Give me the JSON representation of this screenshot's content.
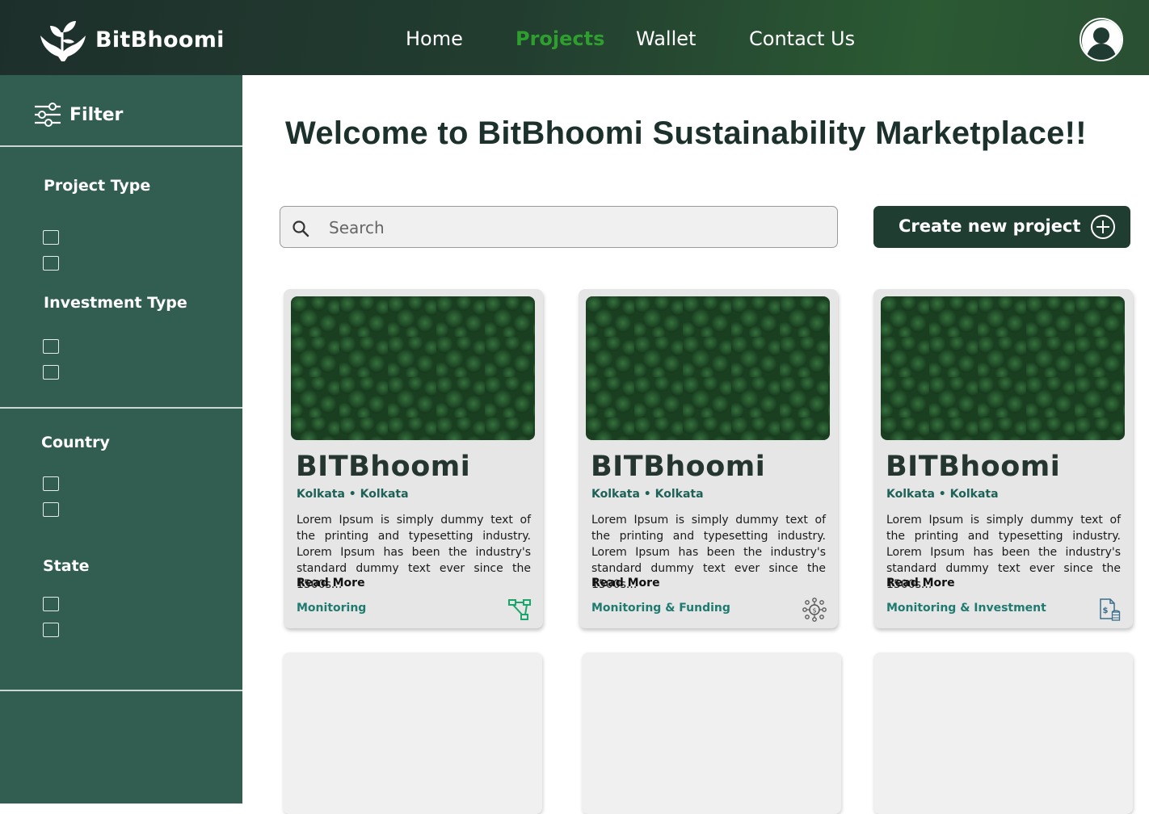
{
  "header": {
    "brand": "BitBhoomi",
    "nav": [
      {
        "label": "Home",
        "active": false
      },
      {
        "label": "Projects",
        "active": true
      },
      {
        "label": "Wallet",
        "active": false
      },
      {
        "label": "Contact Us",
        "active": false
      }
    ],
    "icons": {
      "logo": "hands-plant-logo",
      "profile": "user-avatar-icon"
    }
  },
  "sidebar": {
    "title": "Filter",
    "groups": [
      {
        "label": "Project Type",
        "options": 2
      },
      {
        "label": "Investment Type",
        "options": 2
      },
      {
        "label": "Country",
        "options": 2
      },
      {
        "label": "State",
        "options": 2
      }
    ]
  },
  "main": {
    "title": "Welcome to BitBhoomi Sustainability Marketplace!!",
    "search": {
      "placeholder": "Search"
    },
    "create_button": "Create new project",
    "cards": [
      {
        "title": "BITBhoomi",
        "city": "Kolkata",
        "state": "Kolkata",
        "description": "Lorem Ipsum is simply dummy text of the printing and typesetting industry. Lorem Ipsum has been the industry's standard dummy text ever since the 1500s...",
        "read_more": "Read More",
        "tag": "Monitoring",
        "icon": "network-nodes-icon"
      },
      {
        "title": "BITBhoomi",
        "city": "Kolkata",
        "state": "Kolkata",
        "description": "Lorem Ipsum is simply dummy text of the printing and typesetting industry. Lorem Ipsum has been the industry's standard dummy text ever since the 1500s...",
        "read_more": "Read More",
        "tag": "Monitoring & Funding",
        "icon": "funding-network-icon"
      },
      {
        "title": "BITBhoomi",
        "city": "Kolkata",
        "state": "Kolkata",
        "description": "Lorem Ipsum is simply dummy text of the printing and typesetting industry. Lorem Ipsum has been the industry's standard dummy text ever since the 1500s...",
        "read_more": "Read More",
        "tag": "Monitoring & Investment",
        "icon": "investment-document-icon"
      }
    ]
  },
  "colors": {
    "header_dark": "#1d2f2b",
    "sidebar": "#325e51",
    "nav_active": "#2e9e2e",
    "accent_teal": "#1f7a70",
    "button": "#1f3d31"
  }
}
